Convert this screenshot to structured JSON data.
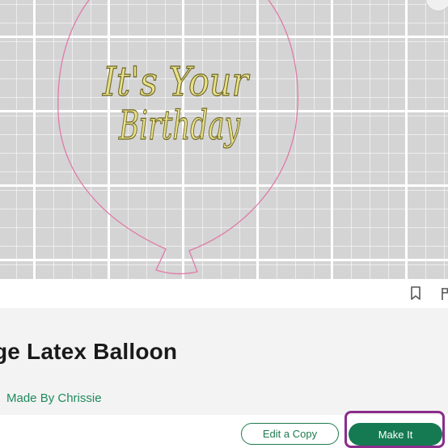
{
  "canvas": {
    "design_text_line1": "It's Your",
    "design_text_line2": "Birthday",
    "balloon_outline_color": "#e07aa8",
    "text_fill_color": "#e8e08a",
    "text_outline_color": "#6b6420"
  },
  "actions": {
    "bookmark_icon": "bookmark-icon",
    "flag_icon": "flag-icon"
  },
  "project": {
    "title": "ge Latex Balloon",
    "author": "Made By Chrissie"
  },
  "buttons": {
    "edit_copy_label": "Edit a Copy",
    "make_it_label": "Make It"
  },
  "colors": {
    "accent_green": "#157a52",
    "highlight_purple": "#8a2c8c"
  }
}
